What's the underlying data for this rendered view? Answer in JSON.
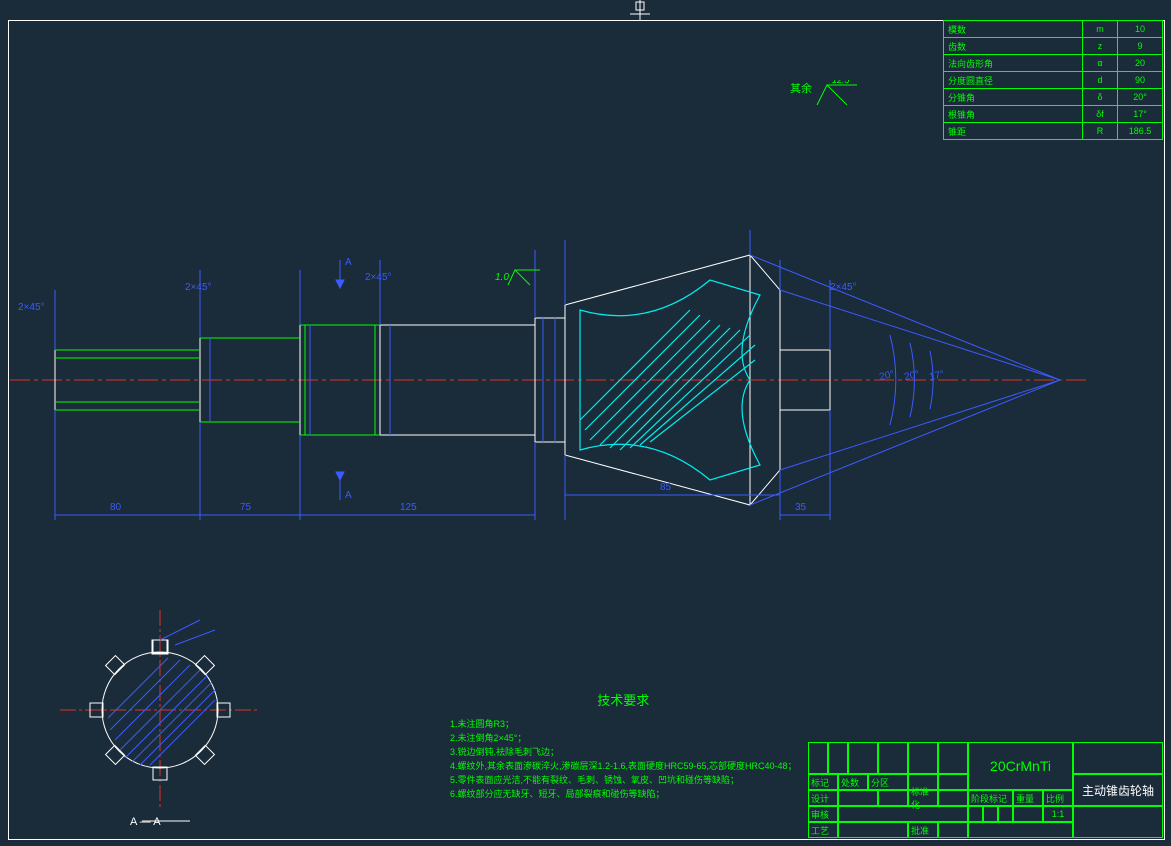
{
  "params": {
    "rows": [
      {
        "label": "模数",
        "sym": "m",
        "val": "10"
      },
      {
        "label": "齿数",
        "sym": "z",
        "val": "9"
      },
      {
        "label": "法向齿形角",
        "sym": "α",
        "val": "20"
      },
      {
        "label": "分度圆直径",
        "sym": "d",
        "val": "90"
      },
      {
        "label": "分锥角",
        "sym": "δ",
        "val": "20°"
      },
      {
        "label": "根锥角",
        "sym": "δf",
        "val": "17°"
      },
      {
        "label": "锥距",
        "sym": "R",
        "val": "186.5"
      }
    ]
  },
  "surface_finish": {
    "label": "其余",
    "value": "12.5"
  },
  "chamfers": {
    "c1": "2×45°",
    "c2": "2×45°",
    "c3": "2×45°",
    "c4": "2×45°"
  },
  "tolerance_label": "1.0",
  "dims": {
    "d1": "80",
    "d2": "75",
    "d3": "125",
    "d4": "85",
    "d5": "35"
  },
  "angles": {
    "a1": "20°",
    "a2": "20°",
    "a3": "17°"
  },
  "section": {
    "label": "A — A",
    "a1": "A",
    "a2": "A"
  },
  "tech": {
    "title": "技术要求",
    "l1": "1.未注圆角R3；",
    "l2": "2.未注倒角2×45°；",
    "l3": "3.锐边倒钝,祛除毛刺飞边；",
    "l4": "4.螺纹外,其余表面渗碳淬火,渗碳层深1.2-1.6,表面硬度HRC59-65,芯部硬度HRC40-48；",
    "l5": "5.零件表面应光洁,不能有裂纹、毛刺、锈蚀、氧皮、凹坑和碰伤等缺陷；",
    "l6": "6.螺纹部分应无缺牙、短牙、局部裂痕和碰伤等缺陷；"
  },
  "title_block": {
    "material": "20CrMnTi",
    "part_name": "主动锥齿轮轴",
    "mark": "标记",
    "count": "处数",
    "zone": "分区",
    "design": "设计",
    "scale_lbl": "标准化",
    "stage": "阶段标记",
    "weight": "重量",
    "ratio_lbl": "比例",
    "ratio": "1:1",
    "check": "审核",
    "craft": "工艺",
    "approve": "批准"
  }
}
